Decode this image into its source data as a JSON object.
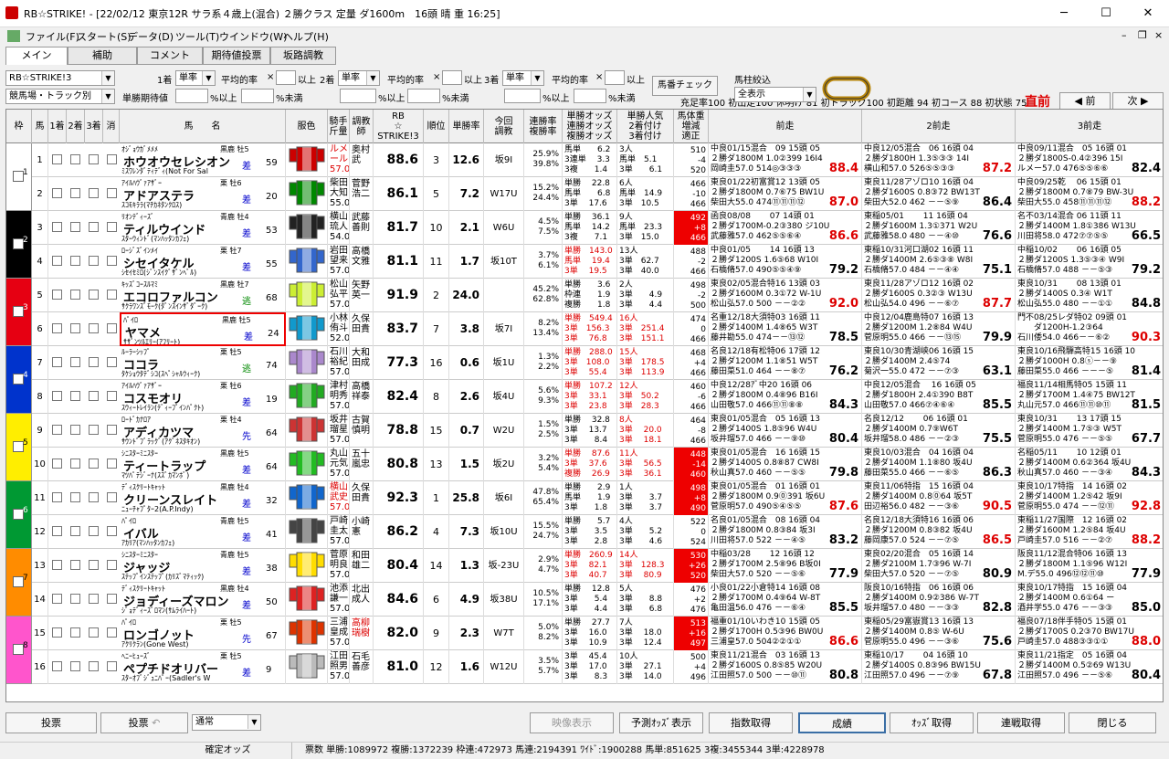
{
  "window": {
    "title": "RB☆STRIKE! - [22/02/12 東京12R サラ系４歳上(混合) ２勝クラス 定量 ダ1600m　16頭 晴 重 16:25]"
  },
  "menu": [
    "ファイル(F)",
    "スタート(S)",
    "データ(D)",
    "ツール(T)",
    "ウインドウ(W)",
    "ヘルプ(H)"
  ],
  "tabs": [
    "メイン",
    "補助",
    "コメント",
    "期待値投票",
    "坂路調教"
  ],
  "stats": "充足率100 初出走100 休明け 81 初トラック100 初距離 94 初コース 88 初状態 75",
  "chokuzen": "直前",
  "nav": {
    "prev": "◀ 前",
    "next": "次 ▶"
  },
  "filter": {
    "app": "RB☆STRIKE!3",
    "sort": "競馬場・トラック別",
    "bet": "単率",
    "avg": "平均的率",
    "x": "×",
    "ijou": "以上",
    "ijou2": "%以上",
    "miman": "%未満",
    "expect": "単勝期待値",
    "chk1": "1着",
    "chk2": "2着",
    "chk3": "3着",
    "umaban_btn": "馬番チェック",
    "colsel": "馬柱絞込",
    "colval": "全表示"
  },
  "headers": [
    "枠",
    "馬",
    "1着",
    "2着",
    "3着",
    "消",
    "馬　　名",
    "服色",
    "騎手\n斤量",
    "調教\n師",
    "RB\n☆\nSTRIKE!3",
    "順位",
    "単勝率",
    "今回\n調教",
    "連勝率\n複勝率",
    "単勝オッズ\n連勝オッズ\n複勝オッズ",
    "単勝人気\n2着付け\n3着付け",
    "馬体重\n増減\n適正",
    "前走",
    "2前走",
    "3前走"
  ],
  "horses": [
    {
      "n": "1",
      "sire": "ｵｼﾞｮｳｶﾞﾒﾒﾒ",
      "sex": "黒鹿 牡5",
      "name": "ホウオウセレシオン",
      "dam": "ﾐｽﾜﾚﾝﾀﾞﾃｨﾃﾞｨ(Not For Sal",
      "style": "差",
      "wt": "59",
      "jky": "ルメ\nール\n57.0",
      "trn": "奥村\n武",
      "rb": "88.6",
      "rk": "3",
      "od": "12.6",
      "ch": "坂9I",
      "ren": "25.9%\n39.8%",
      "o1": "馬単　　6.2\n3連単　 3.3\n3複　　1.4",
      "o2": "3人\n馬単　5.1\n3単　　6.1",
      "wd": "510\n-4\n520",
      "p1": "中良01/15混合　09 15頭 05\n２勝ダ1800M 1.0②399 16I4\n岡崎圭57.0 514◎③③③",
      "b1": "88.4",
      "p2": "中良12/05混合　06 16頭 04\n２勝ダ1800H 1.3⑤③③ 14I\n横山和57.0 526⑤⑤③③",
      "b2": "87.2",
      "p3": "中良09/11混合　05 16頭 01\n２勝ダ1800S-0.4②396 15I\nルメー57.0 476⑤⑤⑥⑥",
      "b3": "82.4"
    },
    {
      "n": "2",
      "sire": "ｱｲﾙﾊｳﾞｧｱｻﾞｰ",
      "sex": "栗 牡6",
      "name": "アドアステラ",
      "dam": "ｽｺﾓｷﾗﾗ(ﾏﾁｶﾈﾀﾝｸﾛｽ)",
      "style": "差",
      "wt": "20",
      "jky": "柴田\n大知\n55.0",
      "trn": "菅野\n浩二",
      "rb": "86.1",
      "rk": "5",
      "od": "7.2",
      "ch": "W17U",
      "ren": "15.2%\n24.4%",
      "o1": "単勝　 22.8\n馬単　　6.8\n3単　 17.6",
      "o2": "6人\n馬単　14.9\n3単　10.5",
      "wd": "466\n-10\n466",
      "p1": "東良01/22初富賞12 13頭 05\n２勝ダ1800M 0.7⑥75 BW1U\n柴田大55.0 474⑪⑪⑪⑫",
      "b1": "87.0",
      "p2": "東良11/28アゾロ10 16頭 04\n２勝ダ1600S 0.8③72 BW13T\n柴田大52.0 462 －－⑤⑨",
      "b2": "86.4",
      "p3": "中良09/25乾　 06 15頭 01\n２勝ダ1800M 0.7⑧79 BW-3U\n柴田大55.0 458⑪⑪⑪⑫",
      "b3": "88.2"
    },
    {
      "n": "3",
      "sire": "ﾘｵﾝﾃﾞｨｰｽﾞ",
      "sex": "青鹿 牡4",
      "name": "ティルウインド",
      "dam": "ｽﾀｰｳｨﾝﾄﾞ(ﾏﾝﾊｯﾀﾝｶﾌｪ)",
      "style": "差",
      "wt": "53",
      "jky": "横山\n琉人\n54.0",
      "trn": "武藤\n善則",
      "rb": "81.7",
      "rk": "10",
      "od": "2.1",
      "ch": "W6U",
      "ren": "4.5%\n7.5%",
      "o1": "単勝　 36.1\n馬単　 14.2\n3複　　7.1",
      "o2": "9人\n馬単　23.3\n3単　15.0",
      "wd": "492\n+8\n466",
      "p1": "函良08/08　　 07 14頭 01\n２勝ダ1700M-0.2③380 ジ10U\n武藤雅57.0 462⑤⑤⑥④",
      "b1": "86.6",
      "p2": "東稲05/01　　 11 16頭 04\n２勝ダ1600M 1.3①371 W2U\n武藤雅58.0 480 －－④⑩",
      "b2": "76.6",
      "p3": "名不03/14混合 06 11頭 11\n２勝ダ1400M 1.8①386 W13U\n川田将58.0 472⑦⑦⑤⑤",
      "b3": "66.5"
    },
    {
      "n": "4",
      "sire": "ﾛｰｼﾞｽﾞｲﾝﾒｲ",
      "sex": "栗 牡7",
      "name": "シセイタケル",
      "dam": "ｼｾｲｾﾐﾛ(ｼﾞﾝｽｲｸﾞｻﾞﾝﾍﾞﾙ)",
      "style": "差",
      "wt": "55",
      "jky": "岩田\n望来\n57.0",
      "trn": "高橋\n文雅",
      "rb": "81.1",
      "rk": "11",
      "od": "1.7",
      "ch": "坂10T",
      "ren": "3.7%\n6.1%",
      "o1": "単勝　143.0\n馬単　 19.4\n3単　 19.5",
      "o2": "13人\n3単　62.7\n3単　40.0",
      "wd": "488\n-2\n466",
      "p1": "中良01/05　　 14 16頭 13\n２勝ダ1200S 1.6⑤68 W10I\n石橋脩57.0 490⑤⑤④⑨",
      "b1": "79.2",
      "p2": "東稲10/31河口湖02 16頭 11\n２勝ダ1400M 2.6⑤③⑧ W8I\n石橋脩57.0 484 －－④④",
      "b2": "75.1",
      "p3": "中稲10/02　　 06 16頭 05\n２勝ダ1200S 1.3⑤③④ W9I\n石橋脩57.0 488 －－⑤③",
      "b3": "79.2"
    },
    {
      "n": "5",
      "sire": "ｷｯｽﾞｺｰｽﾙﾏﾐ",
      "sex": "黒鹿 牡7",
      "name": "エコロファルコン",
      "dam": "ｻｸﾗﾜﾝｽﾞﾓｰｸ(ﾀﾞﾝｽｲﾝｻﾞﾀﾞｰｸ)",
      "style": "逃",
      "wt": "68",
      "jky": "松山\n弘平\n57.0",
      "trn": "矢野\n英一",
      "rb": "91.9",
      "rk": "2",
      "od": "24.0",
      "ch": "",
      "ren": "45.2%\n62.8%",
      "o1": "単勝　　3.6\n枠連　　1.9\n複勝　　1.8",
      "o2": "2人\n3単　　4.9\n3単　　4.4",
      "wd": "498\n-2\n500",
      "p1": "東良02/05混合特16 13頭 03\n２勝ダ1600M 0.3①72 W-1U\n松山弘57.0 500 －－②②",
      "b1": "92.0",
      "p2": "東良11/28アゾロ12 16頭 02\n２勝ダ1600S 0.3②③ W13U\n松山弘54.0 496 －－⑥⑦",
      "b2": "87.7",
      "p3": "東良10/31　　 08 13頭 01\n２勝ダ1400S 0.3④ W1T\n松山弘55.0 480 －－①①",
      "b3": "84.8"
    },
    {
      "n": "6",
      "sire": "ﾊﾟｲﾛ",
      "sex": "黒鹿 牡5",
      "name": "ヤマメ",
      "dam": "ｻｻﾞﾝﾂﾙｴﾘｰ(ｱﾌﾘｰﾄ)",
      "style": "差",
      "wt": "24",
      "jky": "小林\n侑斗\n52.0",
      "trn": "久保\n田貴",
      "rb": "83.7",
      "rk": "7",
      "od": "3.8",
      "ch": "坂7I",
      "ren": "8.2%\n13.4%",
      "o1": "単勝　549.4\n3単　156.3\n3単　 76.8",
      "o2": "16人\n3単　251.4\n3単　151.1",
      "wd": "474\n0\n466",
      "p1": "名重12/18大須特03 16頭 11\n２勝ダ1400M 1.4⑧65 W3T\n藤井勘55.0 474－－⑬⑫",
      "b1": "78.5",
      "p2": "中良12/04鹿島特07 16頭 13\n２勝ダ1200M 1.2⑧84 W4U\n菅原明55.0 466 －－⑬⑮",
      "b2": "79.9",
      "p3": "門不08/25レダ特02 09頭 01\n　　ダ1200H-1.2③64\n石川倭54.0 466－－⑥②",
      "b3": "90.3"
    },
    {
      "n": "7",
      "sire": "ﾙｰﾗｰｼｯﾌﾟ",
      "sex": "栗 牡5",
      "name": "ココラ",
      "dam": "ﾀｹｼｮｳﾀﾃﾞｼｺ(ｽﾍﾟｼｬﾙｳｨｰｸ)",
      "style": "逃",
      "wt": "74",
      "jky": "石川\n裕紀\n57.0",
      "trn": "大和\n田成",
      "rb": "77.3",
      "rk": "16",
      "od": "0.6",
      "ch": "坂1U",
      "ren": "1.3%\n2.2%",
      "o1": "単勝　288.0\n3単　108.0\n3単　 55.4",
      "o2": "15人\n3単　178.5\n3単　113.9",
      "wd": "468\n+4\n466",
      "p1": "名良12/18有松特06 17頭 12\n２勝ダ1200M 1.1⑧51 W5T\n藤田菜51.0 464 －－⑧⑦",
      "b1": "76.2",
      "p2": "東良10/30青湖峡06 16頭 15\n２勝ダ1400M 2.4⑤74\n菊沢一55.0 472 －－⑦③",
      "b2": "63.1",
      "p3": "東良10/16飛驒高特15 16頭 10\n２勝ダ1000H 0.8ⓢ－－⑨\n藤田菜55.0 466 －－－⑤",
      "b3": "81.4"
    },
    {
      "n": "8",
      "sire": "ｱｲﾙﾊｳﾞｧｱｻﾞｰ",
      "sex": "栗 牡6",
      "name": "コスモオリ",
      "dam": "ｽｳｨｰﾄﾚｲﾗﾝ(ﾃﾞｨｰﾌﾟｲﾝﾊﾟｸﾄ)",
      "style": "差",
      "wt": "19",
      "jky": "津村\n明秀\n57.0",
      "trn": "高橋\n祥泰",
      "rb": "82.4",
      "rk": "8",
      "od": "2.6",
      "ch": "坂4U",
      "ren": "5.6%\n9.3%",
      "o1": "単勝　107.2\n3単　 33.1\n3単　 23.8",
      "o2": "12人\n3単　50.2\n3単　28.3",
      "wd": "460\n-6\n466",
      "p1": "中良12/28ｱﾞ中20 16頭 06\n２勝ダ1800M 0.4⑧96 B16I\n山田敬57.0 466⑪⑪⑧⑧",
      "b1": "84.3",
      "p2": "中良12/05混合　 16 16頭 05\n２勝ダ1800H 2.4①390 B8T\n山田敬57.0 466⑦④⑥④",
      "b2": "85.5",
      "p3": "福良11/14相馬特05 15頭 11\n２勝ダ1700M 1.4④75 BW12T\n丸山元57.0 466⑪⑪⑩⑪",
      "b3": "81.5"
    },
    {
      "n": "9",
      "sire": "ﾛｰﾄﾞｶﾅﾛｱ",
      "sex": "栗 牡4",
      "name": "アディカツマ",
      "dam": "ｻｳﾝﾄﾞﾌﾞﾗｯｸﾞ(ｱｸﾞﾈｽﾀｷｵﾝ)",
      "style": "先",
      "wt": "64",
      "jky": "坂井\n瑠星\n57.0",
      "trn": "古賀\n慎明",
      "rb": "78.8",
      "rk": "15",
      "od": "0.7",
      "ch": "W2U",
      "ren": "1.5%\n2.5%",
      "o1": "単勝　 32.8\n3単　 13.7\n3単　　8.4",
      "o2": "8人\n3単　 20.0\n3単　 18.1",
      "wd": "464\n-8\n466",
      "p1": "東良01/05混合　05 16頭 13\n２勝ダ1400S 1.8⑤96 W4U\n坂井瑠57.0 466 －－⑨⑩",
      "b1": "80.4",
      "p2": "名良12/12　　 06 16頭 01\n２勝ダ1400M 0.7⑨W6T\n坂井瑠58.0 486 －－②③",
      "b2": "75.5",
      "p3": "東良10/31　　 13 17頭 15\n２勝ダ1400M 1.7⑤③ W5T\n菅原明55.0 476 －－⑤⑤",
      "b3": "67.7"
    },
    {
      "n": "10",
      "sire": "ｼﾆｽﾀｰﾐﾆｽﾀｰ",
      "sex": "黒鹿 牡5",
      "name": "ティートラップ",
      "dam": "ﾏﾂﾊﾟﾃｼﾞｰﾅ(ｽｽﾞｶﾏﾝﾎﾞ)",
      "style": "差",
      "wt": "64",
      "jky": "丸山\n元気\n57.0",
      "trn": "五十\n嵐忠",
      "rb": "80.8",
      "rk": "13",
      "od": "1.5",
      "ch": "坂2U",
      "ren": "3.2%\n5.4%",
      "o1": "単勝　 87.6\n3単　 37.6\n複勝　 26.9",
      "o2": "11人\n3単　 56.5\n3単　 36.1",
      "wd": "448\n-14\n460",
      "p1": "東良01/05混合　16 16頭 15\n２勝ダ1400S 0.8⑧87 CW8I\n秋山真57.0 460 －－⑤⑤",
      "b1": "79.8",
      "p2": "東良10/03混合　04 16頭 04\n２勝ダ1400M 1.1⑧80 坂4U\n藤田菜55.0 466 －－⑥⑤",
      "b2": "86.3",
      "p3": "名稲05/11　　 10 12頭 01\n２勝ダ1400M 0.6②364 坂4U\n秋山真57.0 460 －－③④",
      "b3": "84.3"
    },
    {
      "n": "11",
      "sire": "ﾃﾞｨｽｸﾘｰﾄｷｬｯﾄ",
      "sex": "黒鹿 牡4",
      "name": "クリーンスレイト",
      "dam": "ﾆｭｰﾁｬﾌﾟﾀｰ2(A.P.Indy)",
      "style": "差",
      "wt": "32",
      "jky": "横山\n武史\n57.0",
      "trn": "久保\n田貴",
      "rb": "92.3",
      "rk": "1",
      "od": "25.8",
      "ch": "坂6I",
      "ren": "47.8%\n65.4%",
      "o1": "単勝　　2.9\n馬単　　1.9\n3単　　1.8",
      "o2": "1人\n3単　　3.7\n3単　　3.7",
      "wd": "498\n+8\n490",
      "p1": "東良01/05混合　01 16頭 01\n２勝ダ1800M 0.9⓪391 坂6U\n菅原明57.0 490⑤④⑤⑤",
      "b1": "87.6",
      "p2": "東良11/06特指　15 16頭 04\n２勝ダ1400M 0.8⓪64 坂5T\n田辺裕56.0 482 －－③⑥",
      "b2": "90.5",
      "p3": "東良10/17特指　14 16頭 02\n２勝ダ1400M 1.2⑤42 坂9I\n菅原明55.0 474 －－⑫⑪",
      "b3": "92.8"
    },
    {
      "n": "12",
      "sire": "ﾊﾟｲﾛ",
      "sex": "青鹿 牡5",
      "name": "イバル",
      "dam": "ｱｶﾘｱ(ﾏﾝﾊｯﾀﾝｶﾌｪ)",
      "style": "差",
      "wt": "41",
      "jky": "戸崎\n圭太\n57.0",
      "trn": "小崎\n憲",
      "rb": "86.2",
      "rk": "4",
      "od": "7.3",
      "ch": "坂10U",
      "ren": "15.5%\n24.7%",
      "o1": "単勝　　5.7\n3単　　3.5\n3単　　2.8",
      "o2": "4人\n3単　　5.2\n3単　　4.6",
      "wd": "522\n0\n524",
      "p1": "名良01/05混合　08 16頭 04\n２勝ダ1800M 0.8③84 坂3I\n川田将57.0 522 －－④⑤",
      "b1": "83.2",
      "p2": "名良12/18大須特16 16頭 06\n２勝ダ1200M 0.8③82 坂4U\n藤岡康57.0 524 －－⑦⑤",
      "b2": "86.5",
      "p3": "東稲11/27国際　12 16頭 02\n２勝ダ1600M 1.2⑤84 坂4U\n戸崎圭57.0 516 －－②⑦",
      "b3": "88.2"
    },
    {
      "n": "13",
      "sire": "ｼﾆｽﾀｰﾐﾆｽﾀｰ",
      "sex": "青鹿 牡5",
      "name": "ジャッジ",
      "dam": "ｽﾃｯﾌﾟｲﾝｽﾃｯﾌﾟ(ｶﾘｽﾞﾏﾃｨｯｸ)",
      "style": "差",
      "wt": "38",
      "jky": "菅原\n明良\n57.0",
      "trn": "和田\n雄二",
      "rb": "80.4",
      "rk": "14",
      "od": "1.3",
      "ch": "坂-23U",
      "ren": "2.9%\n4.7%",
      "o1": "単勝　260.9\n3単　 82.1\n3単　 40.7",
      "o2": "14人\n3単　128.3\n3単　 80.9",
      "wd": "530\n+26\n520",
      "p1": "中稲03/28　　 12 16頭 12\n２勝ダ1700M 2.5⑧96 B坂0I\n柴田大57.0 520 －－⑤⑥",
      "b1": "77.9",
      "p2": "東良02/20混合　05 16頭 14\n２勝ダ2100M 1.7③96 W-7I\n柴田大57.0 520 －－⑦⑤",
      "b2": "80.9",
      "p3": "阪良11/12混合特06 16頭 13\n２勝ダ1800M 1.1⑤96 W12I\nM.デ55.0 496⑫⑫⑪⑩",
      "b3": "77.9"
    },
    {
      "n": "14",
      "sire": "ﾃﾞｨｽｸﾘｰﾄｷｬｯﾄ",
      "sex": "黒鹿 牡4",
      "name": "ジョディーズマロン",
      "dam": "ｼﾞｮﾃﾞｨｰｽﾞﾛﾏﾝ(ｻﾑﾗｲﾊｰﾄ)",
      "style": "差",
      "wt": "50",
      "jky": "池添\n謙一\n57.0",
      "trn": "北出\n成人",
      "rb": "84.6",
      "rk": "6",
      "od": "4.9",
      "ch": "坂38U",
      "ren": "10.5%\n17.1%",
      "o1": "単勝　 12.8\n3単　　5.4\n3単　　4.4",
      "o2": "5人\n3単　　8.8\n3単　　6.8",
      "wd": "476\n+2\n476",
      "p1": "小良01/22小倉特14 16頭 08\n２勝ダ1700M 0.4⑨64 W-8T\n亀田温56.0 476 －－⑥④",
      "b1": "85.5",
      "p2": "阪良10/16特指　06 16頭 06\n２勝ダ1400M 0.9②386 W-7T\n坂井瑠57.0 480 －－③③",
      "b2": "82.8",
      "p3": "東良10/17特指　15 16頭 04\n２勝ダ1400M 0.6①64 ー\n酒井学55.0 476 －－③③",
      "b3": "85.0"
    },
    {
      "n": "15",
      "sire": "ﾊﾟｲﾛ",
      "sex": "栗 牡5",
      "name": "ロンゴノット",
      "dam": "ｱｸﾘｸﾗﾝ(Gone West)",
      "style": "先",
      "wt": "67",
      "jky": "三浦\n皇成\n57.0",
      "trn": "高柳\n瑞樹",
      "rb": "82.0",
      "rk": "9",
      "od": "2.3",
      "ch": "W7T",
      "ren": "5.0%\n8.2%",
      "o1": "単勝　 27.7\n3単　 16.0\n3単　 10.9",
      "o2": "7人\n3単　 18.0\n3単　 12.4",
      "wd": "513\n+16\n497",
      "p1": "福重01/10いわき10 15頭 05\n２勝ダ1700H 0.5③96 BW0U\n三浦皇57.0 504②②①①",
      "b1": "86.6",
      "p2": "東稲05/29富嶽賞13 16頭 13\n２勝ダ1400M 0.8⑤ W-6U\n菅原明55.0 496 －－③⑥",
      "b2": "75.6",
      "p3": "福良07/18伴手特05 15頭 01\n２勝ダ1700S 0.2③70 BW17U\n戸崎圭57.0 488③③①①",
      "b3": "88.0"
    },
    {
      "n": "16",
      "sire": "ﾍﾆｰﾋｭｰｽﾞ",
      "sex": "栗 牡5",
      "name": "ペプチドオリバー",
      "dam": "ｽﾀｰｵﾌﾞｼﾞｭﾆﾊﾟｰ(Sadler's W",
      "style": "差",
      "wt": "9",
      "jky": "江田\n照男\n57.0",
      "trn": "石毛\n善彦",
      "rb": "81.0",
      "rk": "12",
      "od": "1.6",
      "ch": "W12U",
      "ren": "3.5%\n5.7%",
      "o1": "3単　 45.4\n3単　 17.0\n3単　　8.3",
      "o2": "10人\n3単　 27.1\n3単　 14.0",
      "wd": "500\n+4\n496",
      "p1": "東良11/21混合　03 16頭 13\n２勝ダ1600S 0.8⑤85 W20U\n江田照57.0 500 －－⑩⑪",
      "b1": "80.8",
      "p2": "東稲10/17　　 04 16頭 10\n２勝ダ1400S 0.8③96 BW15U\n江田照57.0 496 －－⑦⑨",
      "b2": "67.8",
      "p3": "東良11/21指定　05 16頭 04\n２勝ダ1400M 0.5②69 W13U\n江田照57.0 496 －－⑤⑥",
      "b3": "80.4"
    }
  ],
  "wakucolors": [
    "#ffffff",
    "#000000",
    "#e60012",
    "#0033cc",
    "#ffee00",
    "#009933",
    "#ff8c00",
    "#ff55cc"
  ],
  "bottom": {
    "b1": "投票",
    "b2": "投票",
    "mode": "通常",
    "b3": "映像表示",
    "b4": "予測ｵｯｽﾞ表示",
    "b5": "指数取得",
    "b6": "成績",
    "b7": "ｵｯｽﾞ取得",
    "b8": "連戦取得",
    "b9": "閉じる"
  },
  "status": {
    "kakutei": "確定オッズ",
    "hyo": "票数 単勝:1089972 複勝:1372239 枠連:472973 馬連:2194391 ﾜｲﾄﾞ:1900288 馬単:851625 3複:3455344 3単:4228978"
  }
}
